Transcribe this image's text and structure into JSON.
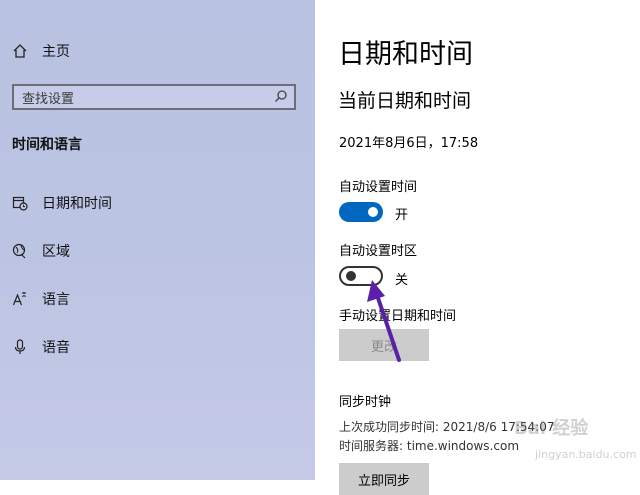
{
  "sidebar": {
    "home_label": "主页",
    "search_placeholder": "查找设置",
    "section_title": "时间和语言",
    "items": [
      {
        "label": "日期和时间",
        "icon": "calendar-clock-icon"
      },
      {
        "label": "区域",
        "icon": "globe-icon"
      },
      {
        "label": "语言",
        "icon": "language-icon"
      },
      {
        "label": "语音",
        "icon": "microphone-icon"
      }
    ]
  },
  "main": {
    "title": "日期和时间",
    "subtitle": "当前日期和时间",
    "current_datetime": "2021年8月6日，17:58",
    "auto_time_label": "自动设置时间",
    "auto_time_state": "开",
    "auto_timezone_label": "自动设置时区",
    "auto_timezone_state": "关",
    "manual_label": "手动设置日期和时间",
    "change_button": "更改",
    "sync_title": "同步时钟",
    "last_sync": "上次成功同步时间: 2021/8/6 17:54:07",
    "time_server": "时间服务器: time.windows.com",
    "sync_now_button": "立即同步"
  },
  "watermark": {
    "text": "Bai 经验",
    "url": "jingyan.baidu.com"
  },
  "colors": {
    "accent": "#0067c0",
    "sidebar_bg": "#bcc4e3",
    "annotation_arrow": "#5b1fa8"
  }
}
